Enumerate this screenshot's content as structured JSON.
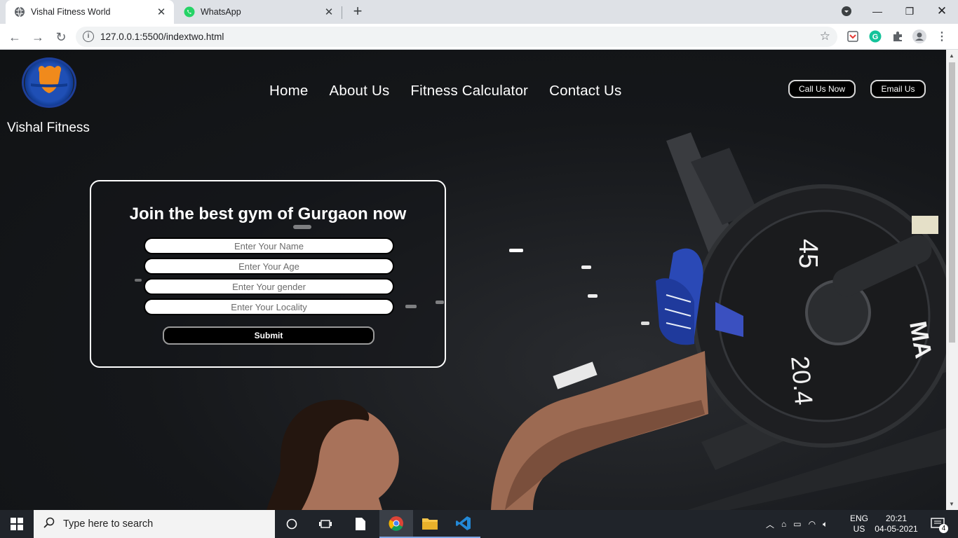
{
  "browser": {
    "tabs": [
      {
        "title": "Vishal Fitness World",
        "active": true
      },
      {
        "title": "WhatsApp",
        "active": false
      }
    ],
    "url": "127.0.0.1:5500/indextwo.html"
  },
  "site": {
    "brand": "Vishal Fitness",
    "nav": [
      "Home",
      "About Us",
      "Fitness Calculator",
      "Contact Us"
    ],
    "call_button": "Call Us Now",
    "email_button": "Email Us",
    "form": {
      "heading": "Join the best gym of Gurgaon now",
      "fields": [
        {
          "placeholder": "Enter Your Name"
        },
        {
          "placeholder": "Enter Your Age"
        },
        {
          "placeholder": "Enter Your gender"
        },
        {
          "placeholder": "Enter Your Locality"
        }
      ],
      "submit": "Submit"
    },
    "plate_labels": {
      "top": "45",
      "bottom": "20.4",
      "side": "MA"
    }
  },
  "taskbar": {
    "search_placeholder": "Type here to search",
    "lang_top": "ENG",
    "lang_bottom": "US",
    "time": "20:21",
    "date": "04-05-2021",
    "notifications": "4"
  },
  "colors": {
    "accent": "#1d3f9a",
    "logo_figure": "#f08a1c"
  }
}
